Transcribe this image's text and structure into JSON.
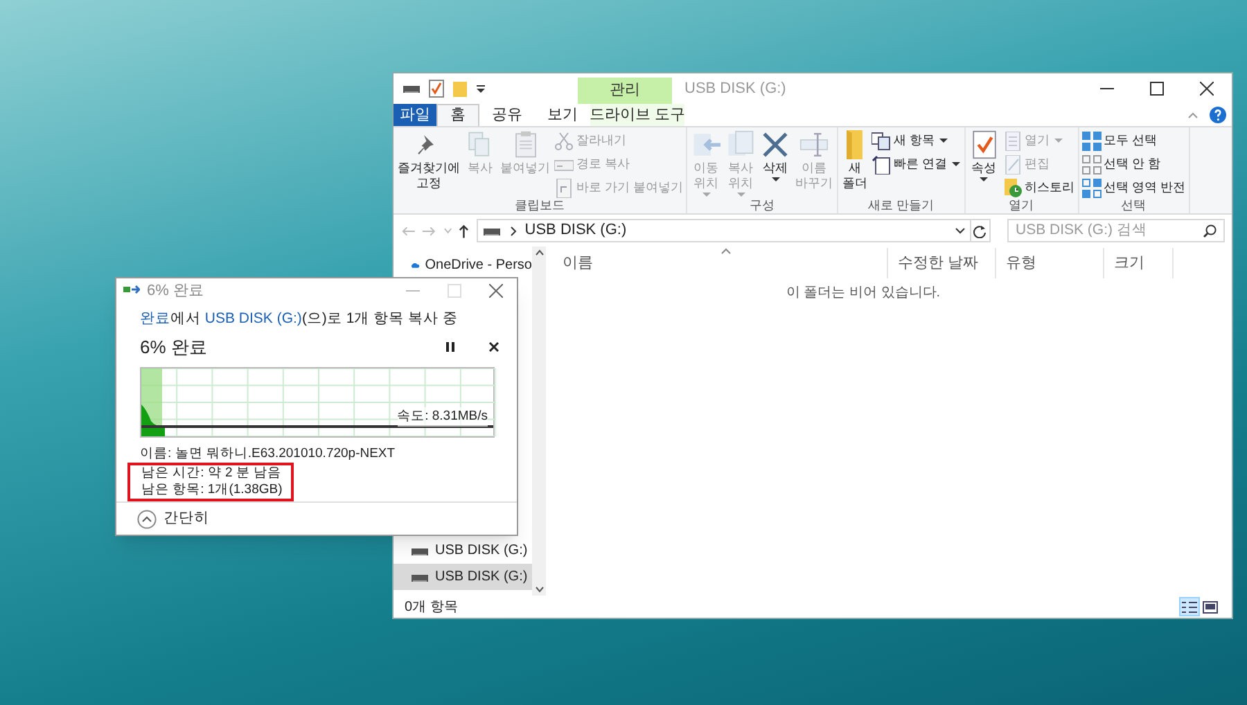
{
  "explorer": {
    "title": "USB DISK (G:)",
    "context_header": "관리",
    "tabs": [
      {
        "label": "파일",
        "kind": "file",
        "selected": false
      },
      {
        "label": "홈",
        "kind": "tab",
        "selected": true
      },
      {
        "label": "공유",
        "kind": "tab",
        "selected": false
      },
      {
        "label": "보기",
        "kind": "tab",
        "selected": false
      },
      {
        "label": "드라이브 도구",
        "kind": "context",
        "selected": false
      }
    ],
    "ribbon_groups": [
      {
        "label": "클립보드",
        "items": [
          {
            "label": "즐겨찾기에 고정",
            "kind": "large",
            "disabled": false,
            "dropdown": false
          },
          {
            "label": "복사",
            "kind": "large",
            "disabled": true,
            "dropdown": false
          },
          {
            "label": "붙여넣기",
            "kind": "large",
            "disabled": true,
            "dropdown": false
          },
          {
            "label": "잘라내기",
            "kind": "small",
            "disabled": true,
            "dropdown": false
          },
          {
            "label": "경로 복사",
            "kind": "small",
            "disabled": true,
            "dropdown": false
          },
          {
            "label": "바로 가기 붙여넣기",
            "kind": "small",
            "disabled": true,
            "dropdown": false
          }
        ]
      },
      {
        "label": "구성",
        "items": [
          {
            "label": "이동 위치",
            "kind": "large",
            "disabled": true,
            "dropdown": true
          },
          {
            "label": "복사 위치",
            "kind": "large",
            "disabled": true,
            "dropdown": true
          },
          {
            "label": "삭제",
            "kind": "large",
            "disabled": false,
            "dropdown": true
          },
          {
            "label": "이름 바꾸기",
            "kind": "large",
            "disabled": true,
            "dropdown": false
          }
        ]
      },
      {
        "label": "새로 만들기",
        "items": [
          {
            "label": "새 폴더",
            "kind": "large",
            "disabled": false,
            "dropdown": false
          },
          {
            "label": "새 항목",
            "kind": "small",
            "disabled": false,
            "dropdown": true
          },
          {
            "label": "빠른 연결",
            "kind": "small",
            "disabled": false,
            "dropdown": true
          }
        ]
      },
      {
        "label": "열기",
        "items": [
          {
            "label": "속성",
            "kind": "large",
            "disabled": false,
            "dropdown": true
          },
          {
            "label": "열기",
            "kind": "small",
            "disabled": true,
            "dropdown": true
          },
          {
            "label": "편집",
            "kind": "small",
            "disabled": true,
            "dropdown": false
          },
          {
            "label": "히스토리",
            "kind": "small",
            "disabled": false,
            "dropdown": false
          }
        ]
      },
      {
        "label": "선택",
        "items": [
          {
            "label": "모두 선택",
            "kind": "small",
            "disabled": false,
            "dropdown": false
          },
          {
            "label": "선택 안 함",
            "kind": "small",
            "disabled": false,
            "dropdown": false
          },
          {
            "label": "선택 영역 반전",
            "kind": "small",
            "disabled": false,
            "dropdown": false
          }
        ]
      }
    ],
    "address": "USB DISK (G:)",
    "search": {
      "placeholder": "USB DISK (G:) 검색"
    },
    "nav_items": [
      {
        "label": "OneDrive - Perso",
        "kind": "cloud",
        "selected": false
      },
      {
        "label": "USB DISK (G:)",
        "kind": "drive",
        "selected": false
      },
      {
        "label": "USB DISK (G:)",
        "kind": "drive",
        "selected": true
      }
    ],
    "columns": [
      {
        "label": "이름",
        "sorted": true
      },
      {
        "label": "수정한 날짜",
        "sorted": false
      },
      {
        "label": "유형",
        "sorted": false
      },
      {
        "label": "크기",
        "sorted": false
      }
    ],
    "empty_message": "이 폴더는 비어 있습니다.",
    "status_bar": "0개 항목",
    "view_buttons": [
      {
        "kind": "details",
        "selected": true
      },
      {
        "kind": "large-icons",
        "selected": false
      }
    ]
  },
  "copy_dialog": {
    "title": "6% 완료",
    "status_line": [
      {
        "text": "완료",
        "kind": "link"
      },
      {
        "text": "에서 ",
        "kind": "text"
      },
      {
        "text": "USB DISK (G:)",
        "kind": "link"
      },
      {
        "text": "(으)로 1개 항목 복사 중",
        "kind": "text"
      }
    ],
    "heading": "6% 완료",
    "level": 0.06,
    "speed": "속도: 8.31MB/s",
    "details": [
      {
        "text": "이름: 놀면 뭐하니.E63.201010.720p-NEXT",
        "highlighted": false
      },
      {
        "text": "남은 시간: 약 2 분 남음",
        "highlighted": true
      },
      {
        "text": "남은 항목: 1개(1.38GB)",
        "highlighted": true
      }
    ],
    "toggle_button": "간단히"
  }
}
